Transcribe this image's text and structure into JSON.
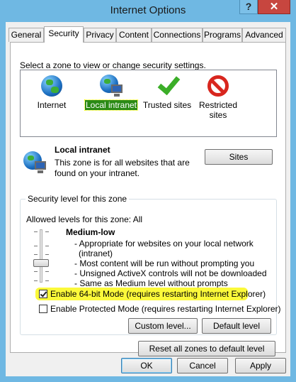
{
  "window": {
    "title": "Internet Options",
    "help_glyph": "?",
    "close_glyph": "✕"
  },
  "tabs": [
    {
      "label": "General"
    },
    {
      "label": "Security",
      "active": true
    },
    {
      "label": "Privacy"
    },
    {
      "label": "Content"
    },
    {
      "label": "Connections"
    },
    {
      "label": "Programs"
    },
    {
      "label": "Advanced"
    }
  ],
  "security": {
    "zone_prompt": "Select a zone to view or change security settings.",
    "zones": [
      {
        "label": "Internet",
        "icon": "globe-icon"
      },
      {
        "label": "Local intranet",
        "icon": "globe-monitor-icon",
        "selected": true
      },
      {
        "label": "Trusted sites",
        "icon": "check-icon"
      },
      {
        "label": "Restricted sites",
        "label_line1": "Restricted",
        "label_line2": "sites",
        "icon": "no-entry-icon"
      }
    ],
    "selected_zone": {
      "title": "Local intranet",
      "description": "This zone is for all websites that are found on your intranet."
    },
    "sites_button": "Sites",
    "level_group": {
      "title": "Security level for this zone",
      "allowed": "Allowed levels for this zone: All",
      "level_name": "Medium-low",
      "level_description": [
        "- Appropriate for websites on your local network",
        "  (intranet)",
        "- Most content will be run without prompting you",
        "- Unsigned ActiveX controls will not be downloaded",
        "- Same as Medium level without prompts"
      ],
      "enable_64bit": {
        "label": "Enable 64-bit Mode (requires restarting Internet Explorer)",
        "checked": true
      },
      "enable_protected": {
        "label": "Enable Protected Mode (requires restarting Internet Explorer)",
        "checked": false
      },
      "custom_level_button": "Custom level...",
      "default_level_button": "Default level"
    },
    "reset_all_button": "Reset all zones to default level"
  },
  "footer": {
    "ok": "OK",
    "cancel": "Cancel",
    "apply": "Apply"
  },
  "colors": {
    "title_bar": "#6fb8e3",
    "close": "#c7463f",
    "selection": "#2b8a16",
    "highlight": "#fbf93a"
  }
}
